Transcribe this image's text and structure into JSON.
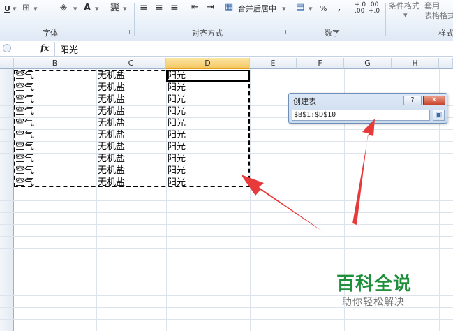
{
  "ribbon": {
    "underline_btn": "U",
    "font_color_btn": "A",
    "phonetic_btn": "變",
    "merge_center_btn": "合并后居中",
    "percent_btn": "%",
    "comma_btn": ",",
    "inc_decimal_btn": "+.0\n.00",
    "dec_decimal_btn": ".00\n+.0",
    "conditional_format_btn": "条件格式",
    "table_format_btn": "套用\n表格格式",
    "groups": {
      "font": "字体",
      "alignment": "对齐方式",
      "number": "数字",
      "styles": "样式"
    }
  },
  "formula_bar": {
    "fx": "fx",
    "content": "阳光"
  },
  "columns": [
    "B",
    "C",
    "D",
    "E",
    "F",
    "G",
    "H"
  ],
  "selected_column": "D",
  "rows": [
    [
      "空气",
      "无机盐",
      "阳光"
    ],
    [
      "空气",
      "无机盐",
      "阳光"
    ],
    [
      "空气",
      "无机盐",
      "阳光"
    ],
    [
      "空气",
      "无机盐",
      "阳光"
    ],
    [
      "空气",
      "无机盐",
      "阳光"
    ],
    [
      "空气",
      "无机盐",
      "阳光"
    ],
    [
      "空气",
      "无机盐",
      "阳光"
    ],
    [
      "空气",
      "无机盐",
      "阳光"
    ],
    [
      "空气",
      "无机盐",
      "阳光"
    ],
    [
      "空气",
      "无机盐",
      "阳光"
    ]
  ],
  "dialog": {
    "title": "创建表",
    "help_btn": "?",
    "close_btn": "✕",
    "range_value": "$B$1:$D$10"
  },
  "watermark": {
    "title": "百科全说",
    "subtitle": "助你轻松解决"
  },
  "colors": {
    "arrow": "#e83a3a",
    "watermark_green": "#1e8f3a",
    "selected_header": "#f5c865"
  }
}
